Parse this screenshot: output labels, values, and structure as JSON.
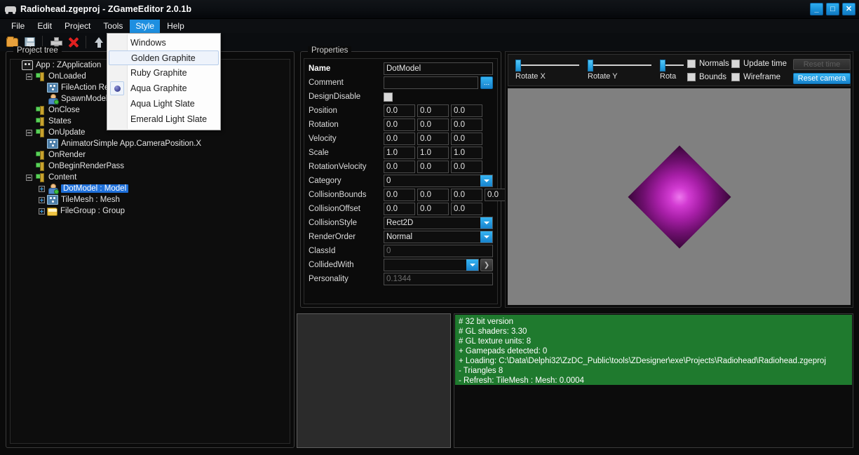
{
  "window": {
    "title": "Radiohead.zgeproj - ZGameEditor 2.0.1b",
    "icon": "car-icon",
    "controls": {
      "minimize": "_",
      "maximize": "□",
      "close": "✕"
    }
  },
  "menubar": {
    "items": [
      {
        "label": "File",
        "active": false
      },
      {
        "label": "Edit",
        "active": false
      },
      {
        "label": "Project",
        "active": false
      },
      {
        "label": "Tools",
        "active": false
      },
      {
        "label": "Style",
        "active": true
      },
      {
        "label": "Help",
        "active": false
      }
    ]
  },
  "toolbar": {
    "buttons": [
      {
        "icon": "open-folder-icon"
      },
      {
        "icon": "save-icon"
      },
      {
        "icon": "add-icon"
      },
      {
        "icon": "delete-icon"
      },
      {
        "icon": "move-up-icon"
      }
    ]
  },
  "style_menu": {
    "items": [
      {
        "label": "Windows",
        "selected": false,
        "checked": false
      },
      {
        "label": "Golden Graphite",
        "selected": true,
        "checked": false
      },
      {
        "label": "Ruby Graphite",
        "selected": false,
        "checked": false
      },
      {
        "label": "Aqua Graphite",
        "selected": false,
        "checked": true
      },
      {
        "label": "Aqua Light Slate",
        "selected": false,
        "checked": false
      },
      {
        "label": "Emerald Light Slate",
        "selected": false,
        "checked": false
      }
    ]
  },
  "project_tree": {
    "caption": "Project tree",
    "nodes": [
      {
        "label": "App : ZApplication",
        "indent": 0,
        "expander": "none",
        "icon": "app-icon",
        "selected": false
      },
      {
        "label": "OnLoaded",
        "indent": 1,
        "expander": "minus",
        "icon": "node-icon",
        "selected": false
      },
      {
        "label": "FileAction  Read",
        "indent": 2,
        "expander": "none",
        "icon": "blue-icon",
        "selected": false
      },
      {
        "label": "SpawnModel  D",
        "indent": 2,
        "expander": "none",
        "icon": "person-icon",
        "selected": false
      },
      {
        "label": "OnClose",
        "indent": 1,
        "expander": "none",
        "icon": "node-icon",
        "selected": false
      },
      {
        "label": "States",
        "indent": 1,
        "expander": "none",
        "icon": "node-icon",
        "selected": false
      },
      {
        "label": "OnUpdate",
        "indent": 1,
        "expander": "minus",
        "icon": "node-icon",
        "selected": false
      },
      {
        "label": "AnimatorSimple  App.CameraPosition.X",
        "indent": 2,
        "expander": "none",
        "icon": "blue-icon",
        "selected": false
      },
      {
        "label": "OnRender",
        "indent": 1,
        "expander": "none",
        "icon": "node-icon",
        "selected": false
      },
      {
        "label": "OnBeginRenderPass",
        "indent": 1,
        "expander": "none",
        "icon": "node-icon",
        "selected": false
      },
      {
        "label": "Content",
        "indent": 1,
        "expander": "minus",
        "icon": "node-icon",
        "selected": false
      },
      {
        "label": "DotModel : Model",
        "indent": 2,
        "expander": "plus",
        "icon": "person-icon",
        "selected": true
      },
      {
        "label": "TileMesh : Mesh",
        "indent": 2,
        "expander": "plus",
        "icon": "blue-icon",
        "selected": false
      },
      {
        "label": "FileGroup : Group",
        "indent": 2,
        "expander": "plus",
        "icon": "folder-icon",
        "selected": false
      }
    ]
  },
  "properties": {
    "caption": "Properties",
    "rows": [
      {
        "label": "Name",
        "type": "text",
        "value": "DotModel",
        "bold": true
      },
      {
        "label": "Comment",
        "type": "text-ellipsis",
        "value": "",
        "button": "..."
      },
      {
        "label": "DesignDisable",
        "type": "checkbox",
        "checked": false
      },
      {
        "label": "Position",
        "type": "vec3",
        "values": [
          "0.0",
          "0.0",
          "0.0"
        ]
      },
      {
        "label": "Rotation",
        "type": "vec3",
        "values": [
          "0.0",
          "0.0",
          "0.0"
        ]
      },
      {
        "label": "Velocity",
        "type": "vec3",
        "values": [
          "0.0",
          "0.0",
          "0.0"
        ]
      },
      {
        "label": "Scale",
        "type": "vec3",
        "values": [
          "1.0",
          "1.0",
          "1.0"
        ]
      },
      {
        "label": "RotationVelocity",
        "type": "vec3",
        "values": [
          "0.0",
          "0.0",
          "0.0"
        ]
      },
      {
        "label": "Category",
        "type": "combo",
        "value": "0"
      },
      {
        "label": "CollisionBounds",
        "type": "vec4",
        "values": [
          "0.0",
          "0.0",
          "0.0",
          "0.0"
        ]
      },
      {
        "label": "CollisionOffset",
        "type": "vec3",
        "values": [
          "0.0",
          "0.0",
          "0.0"
        ]
      },
      {
        "label": "CollisionStyle",
        "type": "combo",
        "value": "Rect2D"
      },
      {
        "label": "RenderOrder",
        "type": "combo",
        "value": "Normal"
      },
      {
        "label": "ClassId",
        "type": "text",
        "value": "0",
        "dim": true
      },
      {
        "label": "CollidedWith",
        "type": "combo-go",
        "value": "",
        "go": "❯"
      },
      {
        "label": "Personality",
        "type": "text",
        "value": "0.1344",
        "dim": true
      }
    ]
  },
  "preview": {
    "sliders": [
      {
        "label": "Rotate X",
        "value": 0
      },
      {
        "label": "Rotate Y",
        "value": 0
      },
      {
        "label": "Rota",
        "value": 0
      }
    ],
    "checkboxes": [
      {
        "label": "Normals",
        "checked": false
      },
      {
        "label": "Bounds",
        "checked": false
      },
      {
        "label": "Update time",
        "checked": false
      },
      {
        "label": "Wireframe",
        "checked": false
      }
    ],
    "buttons": [
      {
        "label": "Reset time",
        "style": "disabled"
      },
      {
        "label": "Reset camera",
        "style": "primary"
      }
    ],
    "model": {
      "shape": "diamond",
      "center_color": "#ee78ee",
      "edge_color": "#3a063a"
    },
    "background_color": "#808080"
  },
  "log": {
    "lines": [
      "# 32 bit version",
      "# GL shaders: 3.30",
      "# GL texture units: 8",
      "+ Gamepads detected: 0",
      "+ Loading: C:\\Data\\Delphi32\\ZzDC_Public\\tools\\ZDesigner\\exe\\Projects\\Radiohead\\Radiohead.zgeproj",
      "-  Triangles 8",
      "-  Refresh: TileMesh : Mesh: 0.0004"
    ],
    "background_color": "#1f7a2e"
  }
}
